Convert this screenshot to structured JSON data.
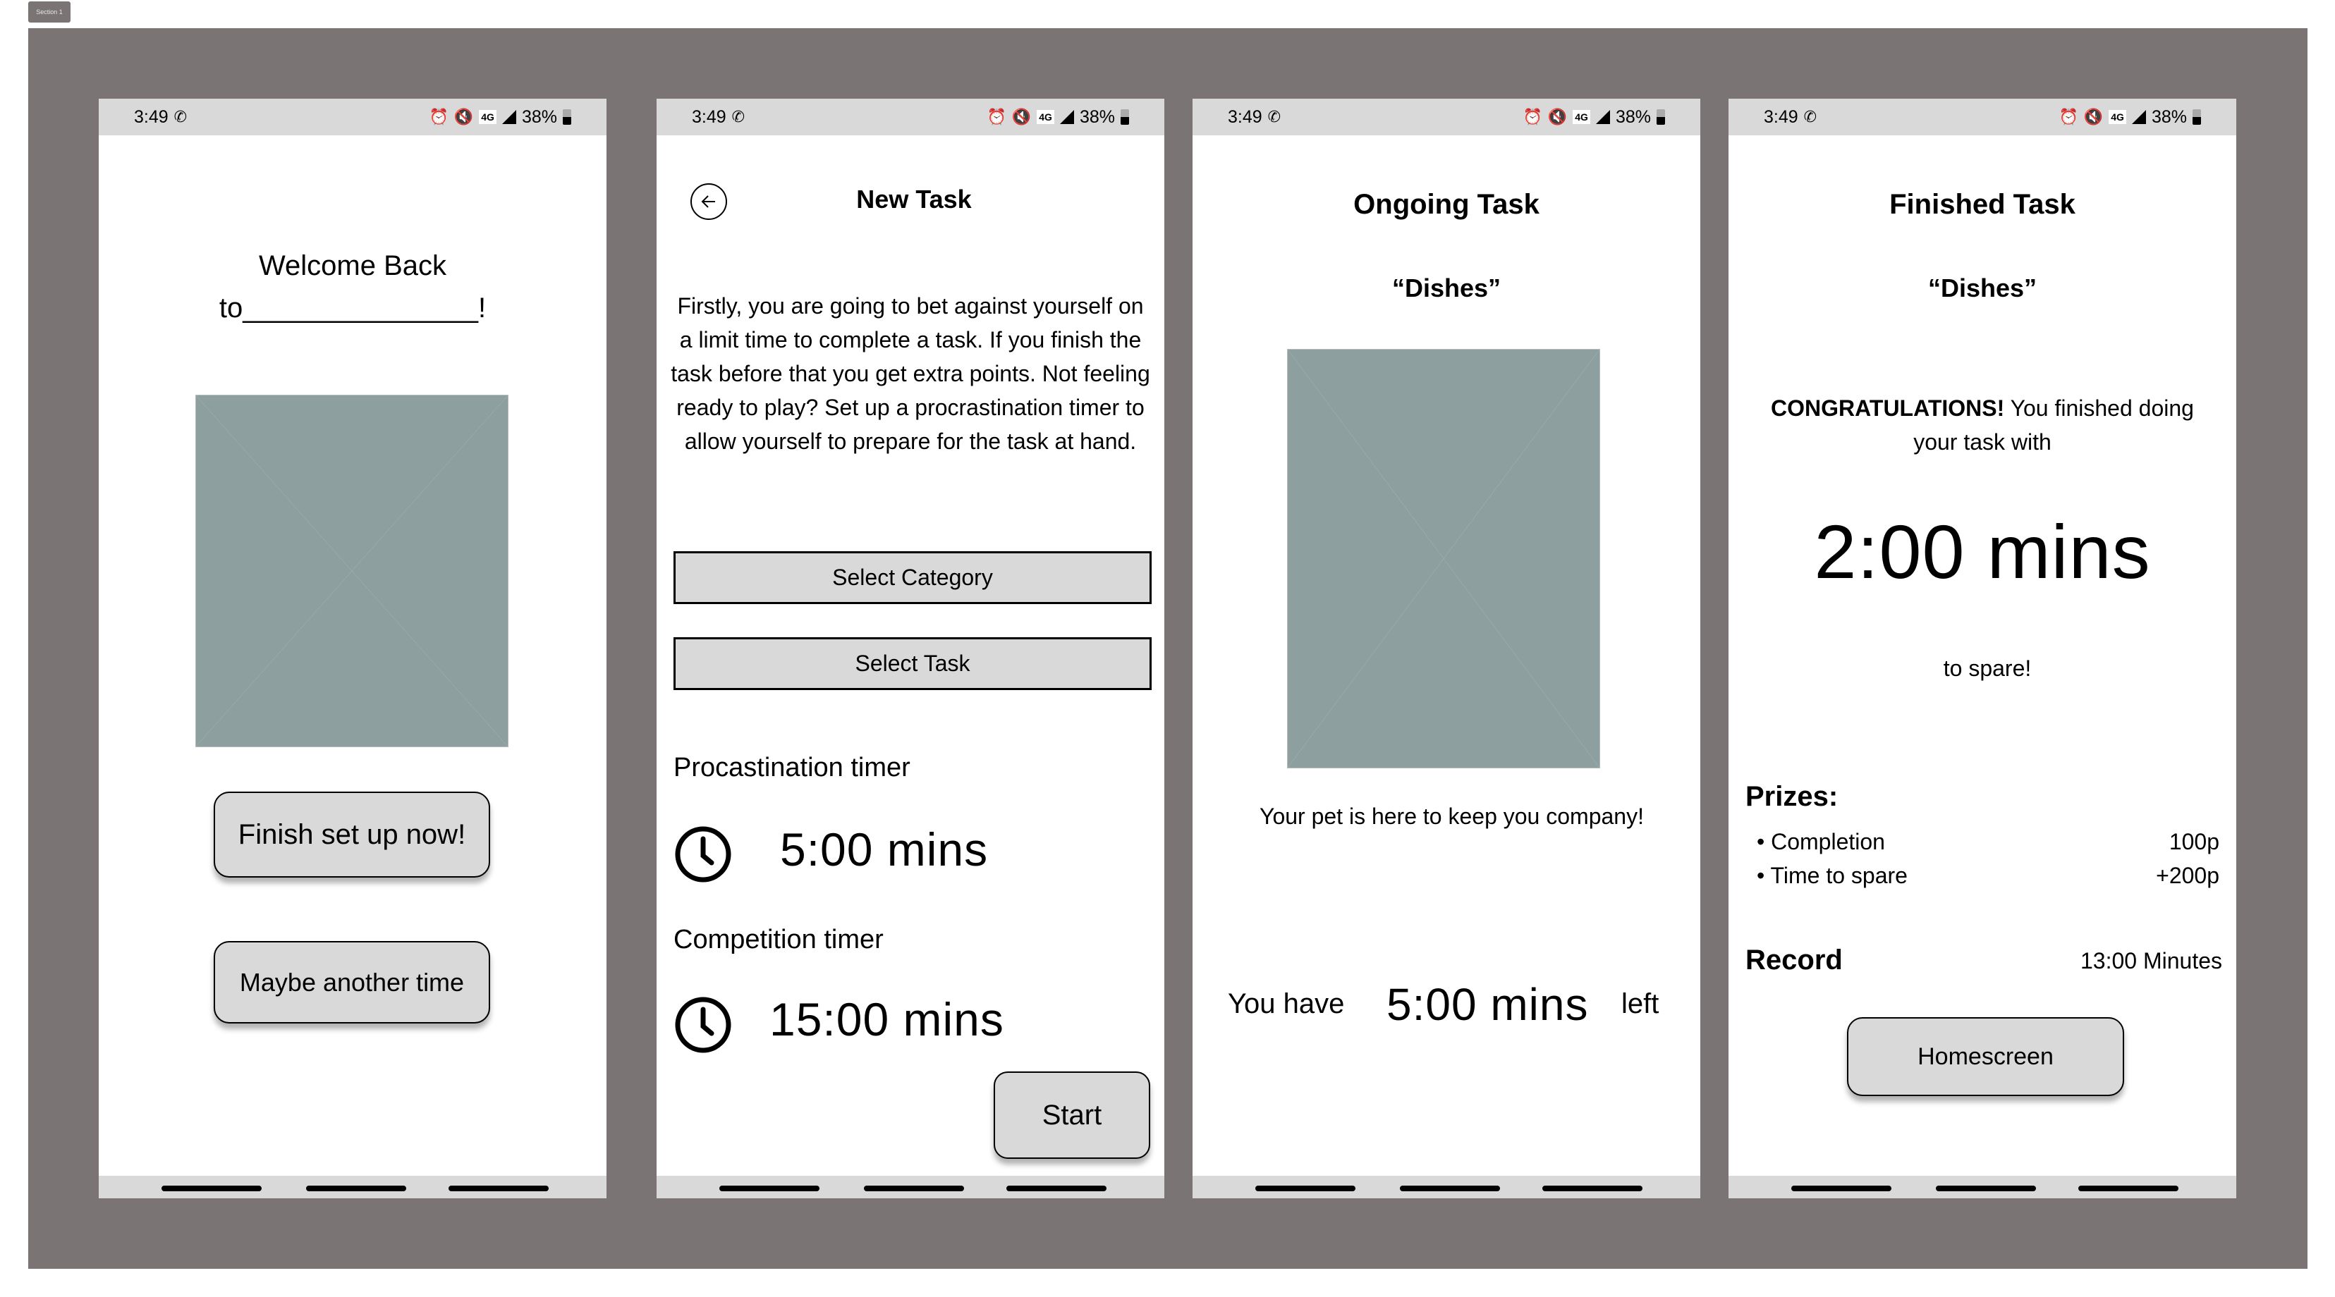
{
  "canvas": {
    "section_label": "Section 1"
  },
  "status_bar": {
    "time": "3:49",
    "battery": "38%",
    "network": "4G",
    "icons": [
      "whatsapp-icon",
      "alarm-icon",
      "vibrate-mute-icon",
      "4g-icon",
      "signal-icon",
      "battery-icon"
    ]
  },
  "screens": {
    "welcome": {
      "title_line1": "Welcome Back",
      "title_line2": "to_______________!",
      "image_placeholder": "placeholder-image",
      "primary_button": "Finish set up now!",
      "secondary_button": "Maybe another time"
    },
    "new_task": {
      "title": "New Task",
      "back_icon": "back-arrow-icon",
      "description": "Firstly, you are going to bet against yourself on a limit time to complete a task. If you finish the task before that you get extra points. Not feeling ready to play? Set up a procrastination timer to allow yourself to prepare for the task at hand.",
      "select_category": "Select Category",
      "select_task": "Select Task",
      "procrastination_label": "Procastination timer",
      "procrastination_value": "5:00 mins",
      "competition_label": "Competition timer",
      "competition_value": "15:00 mins",
      "start_button": "Start"
    },
    "ongoing_task": {
      "title": "Ongoing Task",
      "task_name": "“Dishes”",
      "image_placeholder": "pet-placeholder-image",
      "pet_message": "Your pet is here to keep you company!",
      "remaining_prefix": "You have",
      "remaining_value": "5:00 mins",
      "remaining_suffix": "left"
    },
    "finished_task": {
      "title": "Finished Task",
      "task_name": "“Dishes”",
      "congrats_bold": "CONGRATULATIONS!",
      "congrats_rest": " You finished doing your task with",
      "spare_value": "2:00 mins",
      "spare_suffix": "to spare!",
      "prizes_label": "Prizes:",
      "prizes": [
        {
          "name": "Completion",
          "points": "100p"
        },
        {
          "name": "Time to spare",
          "points": "+200p"
        }
      ],
      "record_label": "Record",
      "record_value": "13:00 Minutes",
      "homescreen_button": "Homescreen"
    }
  },
  "colors": {
    "board": "#7a7574",
    "bars": "#d9d9d9",
    "placeholder": "#8e9f9f",
    "button": "#d9d9d9"
  }
}
